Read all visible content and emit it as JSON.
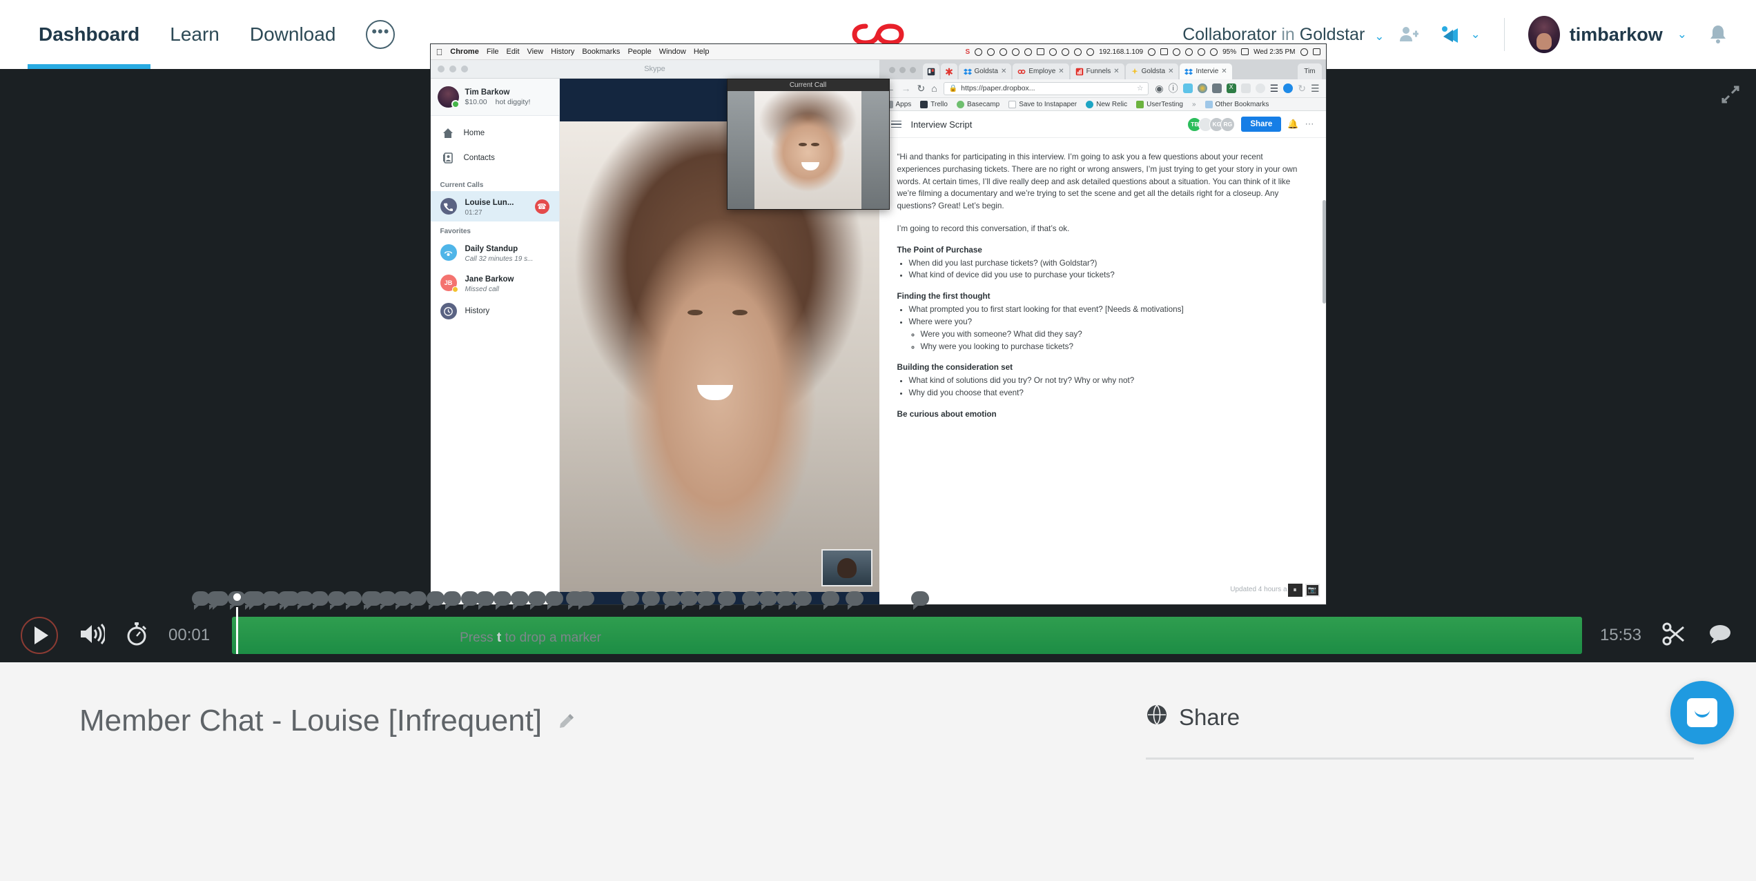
{
  "theme": {
    "accent_blue": "#29abe2",
    "player_bg": "#1b2023",
    "page_bg": "#f4f4f4",
    "progress_green": "#1d8d45",
    "share_button_blue": "#167ee6",
    "intercom_blue": "#1f9ae0"
  },
  "header": {
    "nav": [
      {
        "label": "Dashboard",
        "active": true
      },
      {
        "label": "Learn",
        "active": false
      },
      {
        "label": "Download",
        "active": false
      }
    ],
    "more_label": "•••",
    "more_icon": "ellipsis-icon",
    "logo_icon": "infinity-logo",
    "account_role": "Collaborator",
    "account_in": "in",
    "account_org": "Goldstar",
    "account_caret": "⌄",
    "add_user_icon": "add-user-icon",
    "megaphone_icon": "megaphone-icon",
    "megaphone_caret": "⌄",
    "username": "timbarkow",
    "username_caret": "⌄",
    "avatar_icon": "user-avatar",
    "bell_icon": "notification-bell-icon"
  },
  "player": {
    "expand_icon": "fullscreen-expand-icon",
    "play_icon": "play-icon",
    "volume_icon": "volume-icon",
    "speed_icon": "stopwatch-icon",
    "current_time": "00:01",
    "duration": "15:53",
    "clip_icon": "scissors-icon",
    "comment_icon": "comment-bubble-icon",
    "marker_hint_pre": "Press",
    "marker_hint_key": "t",
    "marker_hint_post": "to drop a marker",
    "progress_percent": 0.3,
    "comment_markers": [
      278,
      300,
      305,
      330,
      352,
      358,
      380,
      402,
      408,
      428,
      450,
      475,
      498,
      524,
      528,
      548,
      570,
      592,
      618,
      642,
      668,
      690,
      715,
      740,
      765,
      790,
      820,
      835,
      900,
      930,
      960,
      985,
      1010,
      1040,
      1075,
      1100,
      1125,
      1150,
      1190,
      1225,
      1320
    ]
  },
  "recording": {
    "macbar": {
      "apple_icon": "apple-logo-icon",
      "menus": [
        "Chrome",
        "File",
        "Edit",
        "View",
        "History",
        "Bookmarks",
        "People",
        "Window",
        "Help"
      ],
      "status_ip": "192.168.1.109",
      "battery": "95%",
      "clock": "Wed 2:35 PM",
      "search_icon": "spotlight-search-icon",
      "notification_icon": "notification-center-icon"
    },
    "skype": {
      "window_title": "Skype",
      "me": {
        "name": "Tim Barkow",
        "credit": "$10.00",
        "mood": "hot diggity!",
        "status_icon": "online-status-icon"
      },
      "nav": [
        {
          "label": "Home",
          "icon": "home-icon"
        },
        {
          "label": "Contacts",
          "icon": "contacts-icon"
        }
      ],
      "current_calls_header": "Current Calls",
      "current_call": {
        "name": "Louise Lun...",
        "duration": "01:27",
        "icon": "phone-icon",
        "hangup_icon": "hangup-icon"
      },
      "favorites_header": "Favorites",
      "favorites": [
        {
          "name": "Daily Standup",
          "sub": "Call 32 minutes 19 s...",
          "icon": "group-call-icon",
          "initials": ""
        },
        {
          "name": "Jane Barkow",
          "sub": "Missed call",
          "icon": "",
          "initials": "JB"
        }
      ],
      "history": {
        "label": "History",
        "icon": "clock-icon"
      },
      "current_call_window_title": "Current Call",
      "action_icons": [
        "add-person-icon",
        "grid-icon",
        "more-icon"
      ]
    },
    "chrome": {
      "tabs": [
        {
          "title": "",
          "icon": "trello-icon",
          "pinned": true
        },
        {
          "title": "",
          "icon": "asterisk-icon",
          "pinned": true
        },
        {
          "title": "Goldsta",
          "icon": "dropbox-icon",
          "active": false
        },
        {
          "title": "Employe",
          "icon": "employe-icon",
          "active": false
        },
        {
          "title": "Funnels",
          "icon": "chart-icon",
          "active": false
        },
        {
          "title": "Goldsta",
          "icon": "sparkle-icon",
          "active": false
        },
        {
          "title": "Intervie",
          "icon": "dropbox-icon",
          "active": true
        }
      ],
      "profile_label": "Tim",
      "url": "https://paper.dropbox...",
      "lock_icon": "lock-icon",
      "star_icon": "bookmark-star-icon",
      "back_icon": "back-arrow-icon",
      "forward_icon": "forward-arrow-icon",
      "reload_icon": "reload-icon",
      "home_icon": "home-icon",
      "menu_icon": "chrome-menu-icon",
      "bookmarks": [
        {
          "label": "Apps",
          "icon": "apps-grid-icon"
        },
        {
          "label": "Trello",
          "icon": "trello-icon"
        },
        {
          "label": "Basecamp",
          "icon": "basecamp-icon"
        },
        {
          "label": "Save to Instapaper",
          "icon": "instapaper-icon"
        },
        {
          "label": "New Relic",
          "icon": "newrelic-icon"
        },
        {
          "label": "UserTesting",
          "icon": "usertesting-icon"
        },
        {
          "label": "»",
          "icon": "overflow-icon"
        },
        {
          "label": "Other Bookmarks",
          "icon": "folder-icon"
        }
      ]
    },
    "paper": {
      "doc_title": "Interview Script",
      "menu_icon": "hamburger-menu-icon",
      "avatars": [
        {
          "initials": "TB",
          "color": "#2bbd5b"
        },
        {
          "initials": "",
          "color": "#e4e7e9"
        },
        {
          "initials": "KG",
          "color": "#c3c8cc"
        },
        {
          "initials": "RG",
          "color": "#c3c8cc"
        }
      ],
      "share_label": "Share",
      "bell_icon": "notification-bell-icon",
      "more_icon": "more-options-icon",
      "intro": "“Hi and thanks for participating in this interview. I’m going to ask you a few questions about your recent experiences purchasing tickets. There are no right or wrong answers, I’m just trying to get your story in your own words. At certain times, I’ll dive really deep and ask detailed questions about a situation. You can think of it like we’re filming a documentary and we’re trying to set the scene and get all the details right for a closeup. Any questions? Great! Let’s begin.",
      "record_notice": "I’m going to record this conversation, if that’s ok.",
      "sections": [
        {
          "heading": "The Point of Purchase",
          "items": [
            {
              "text": "When did you last purchase tickets? (with Goldstar?)",
              "sub": []
            },
            {
              "text": "What kind of device did you use to purchase your tickets?",
              "sub": []
            }
          ]
        },
        {
          "heading": "Finding the first thought",
          "items": [
            {
              "text": "What prompted you to first start looking for that event? [Needs & motivations]",
              "sub": []
            },
            {
              "text": "Where were you?",
              "sub": [
                "Were you with someone? What did they say?",
                "Why were you looking to purchase tickets?"
              ]
            }
          ]
        },
        {
          "heading": "Building the consideration set",
          "items": [
            {
              "text": "What kind of solutions did you try? Or not try? Why or why not?",
              "sub": []
            },
            {
              "text": "Why did you choose that event?",
              "sub": []
            }
          ]
        },
        {
          "heading": "Be curious about emotion",
          "items": []
        }
      ],
      "updated": "Updated 4 hours a",
      "control_icons": [
        "pause-icon",
        "picture-icon"
      ]
    }
  },
  "bottom": {
    "recording_title": "Member Chat - Louise [Infrequent]",
    "edit_icon": "edit-pencil-icon",
    "share_heading": "Share",
    "share_icon": "globe-icon",
    "intercom_icon": "intercom-messenger-icon"
  }
}
